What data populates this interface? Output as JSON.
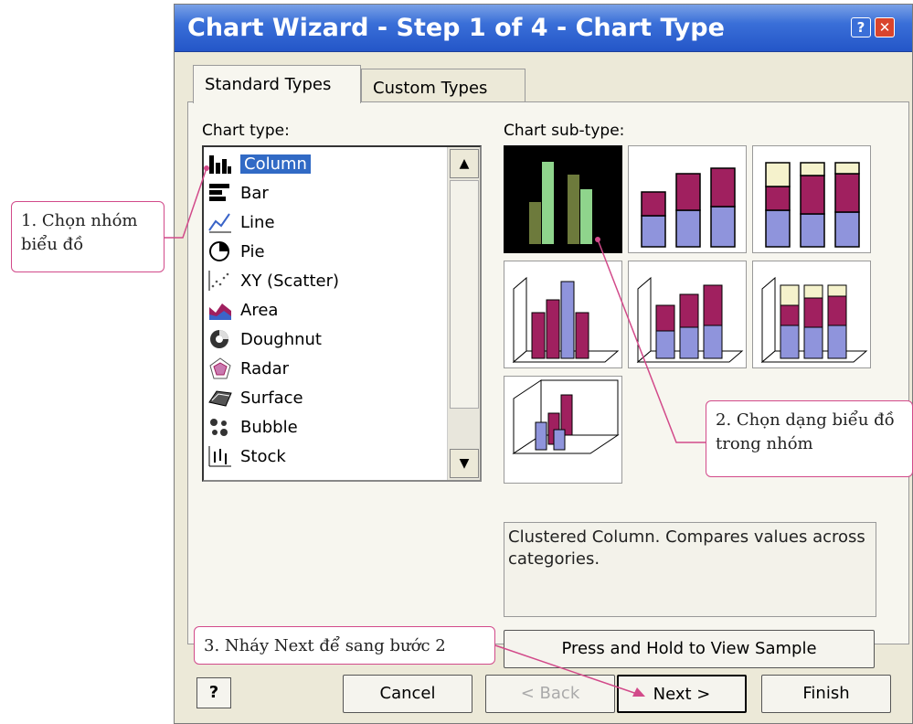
{
  "window": {
    "title": "Chart Wizard - Step 1 of 4 - Chart Type",
    "help_glyph": "?",
    "close_glyph": "✕"
  },
  "tabs": [
    {
      "label": "Standard Types"
    },
    {
      "label": "Custom Types"
    }
  ],
  "chart_type_label": "Chart type:",
  "chart_subtype_label": "Chart sub-type:",
  "chart_types": [
    {
      "label": "Column",
      "icon": "column-icon"
    },
    {
      "label": "Bar",
      "icon": "bar-icon"
    },
    {
      "label": "Line",
      "icon": "line-icon"
    },
    {
      "label": "Pie",
      "icon": "pie-icon"
    },
    {
      "label": "XY (Scatter)",
      "icon": "scatter-icon"
    },
    {
      "label": "Area",
      "icon": "area-icon"
    },
    {
      "label": "Doughnut",
      "icon": "doughnut-icon"
    },
    {
      "label": "Radar",
      "icon": "radar-icon"
    },
    {
      "label": "Surface",
      "icon": "surface-icon"
    },
    {
      "label": "Bubble",
      "icon": "bubble-icon"
    },
    {
      "label": "Stock",
      "icon": "stock-icon"
    }
  ],
  "selected_chart_type": "Column",
  "description": "Clustered Column. Compares values across categories.",
  "buttons": {
    "view_sample": "Press and Hold to View Sample",
    "help": "?",
    "cancel": "Cancel",
    "back": "< Back",
    "next": "Next >",
    "finish": "Finish"
  },
  "callouts": {
    "step1": "1. Chọn nhóm biểu đồ",
    "step2": "2. Chọn dạng biểu đồ trong nhóm",
    "step3": "3. Nháy Next để sang bước 2"
  },
  "colors": {
    "title_bar": "#2456c8",
    "selection": "#316ac5",
    "series_blue": "#8f94dc",
    "series_magenta": "#a0205f",
    "series_cream": "#f5f2cc",
    "selected_green": "#8fd48c",
    "callout_line": "#d24a8a"
  }
}
